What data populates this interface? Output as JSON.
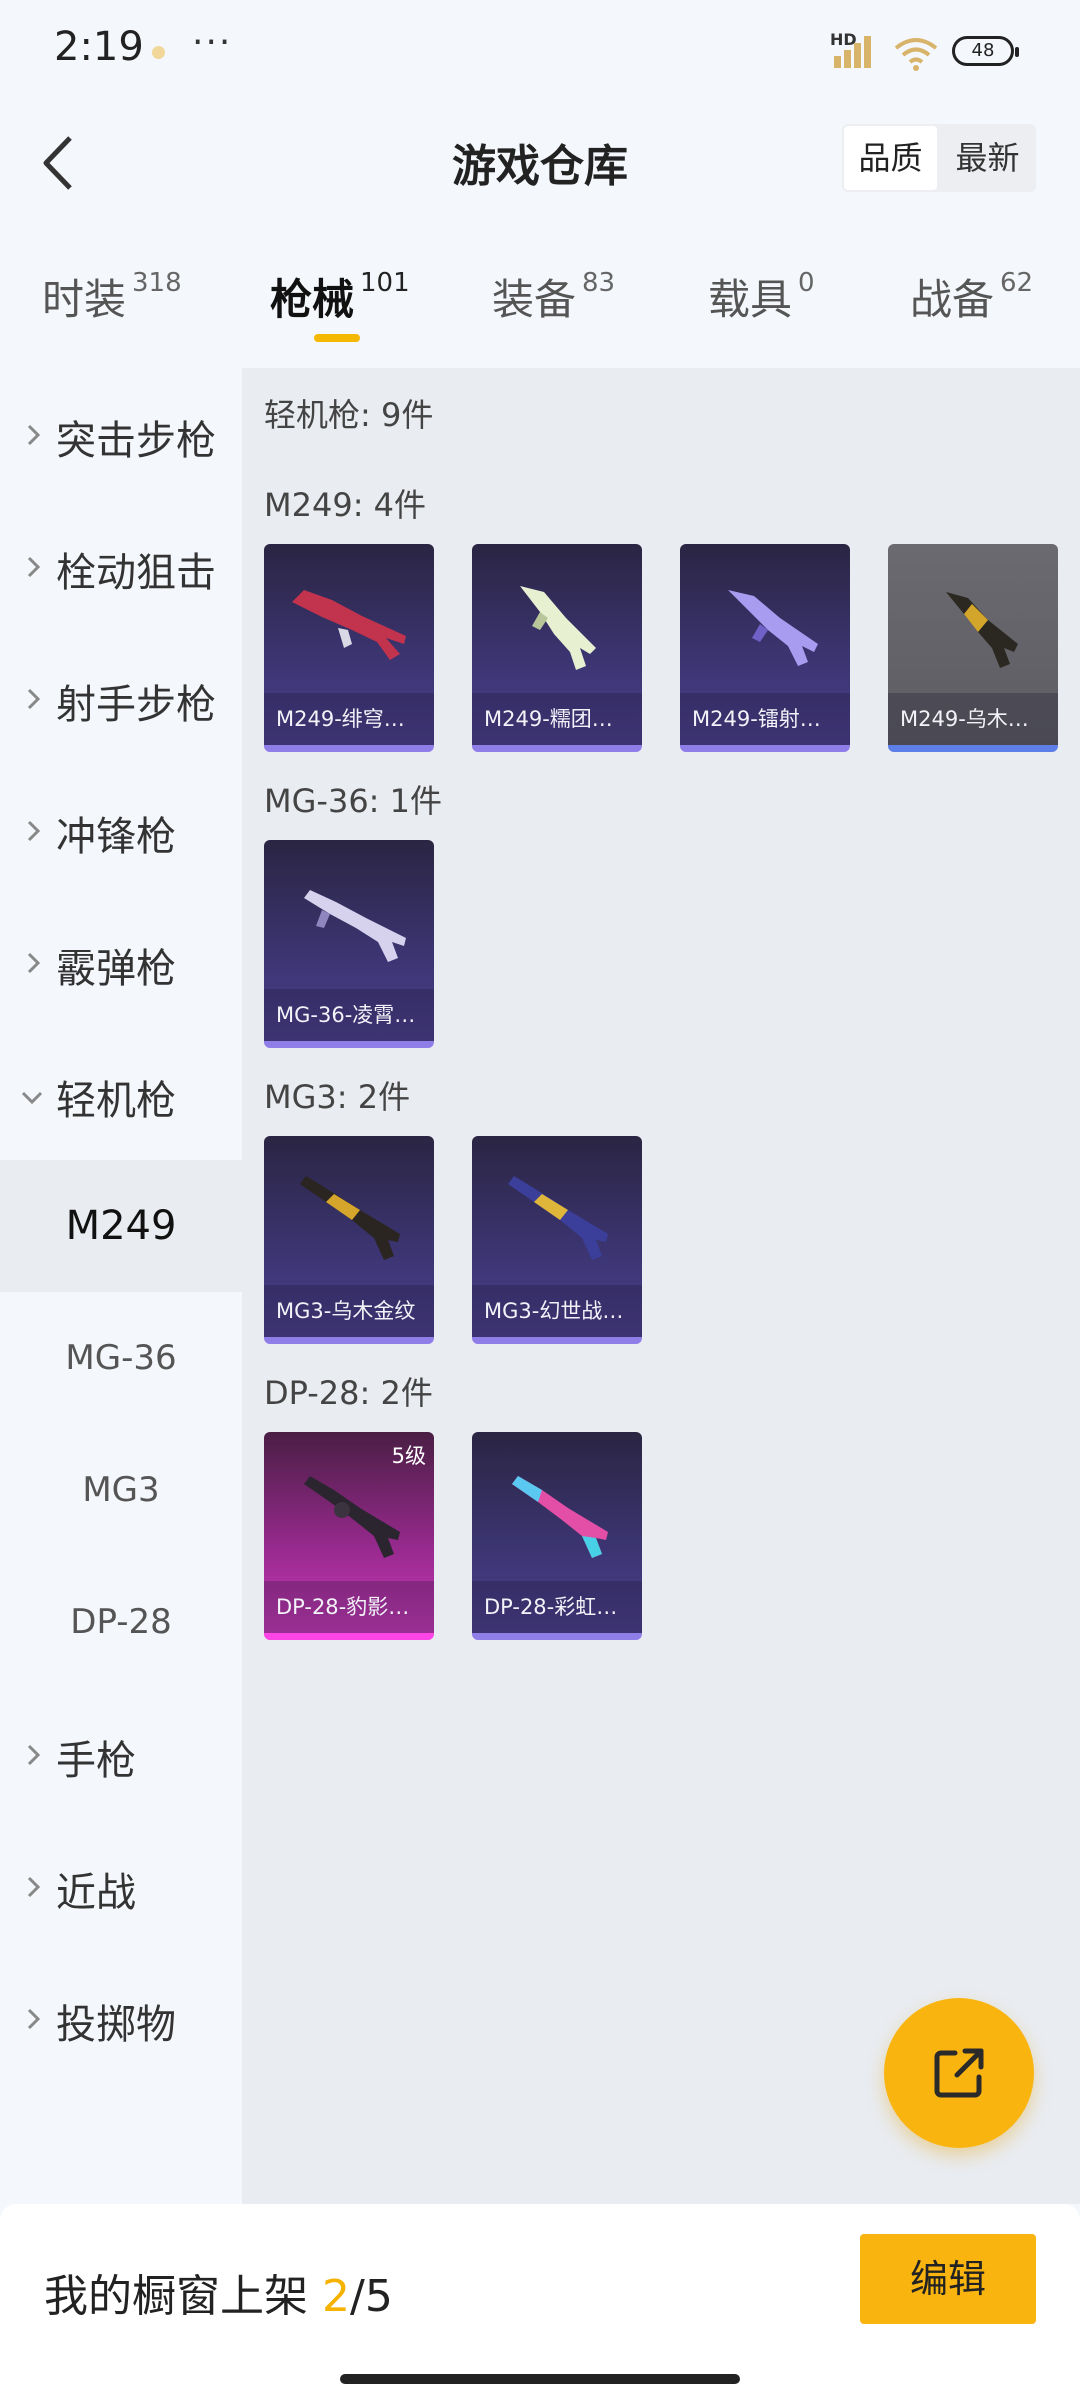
{
  "status": {
    "time": "2:19",
    "more": "···",
    "hd": "HD",
    "battery": "48"
  },
  "header": {
    "title": "游戏仓库",
    "sort_options": [
      "品质",
      "最新"
    ],
    "sort_active": "品质"
  },
  "category_tabs": [
    {
      "label": "时装",
      "count": "318"
    },
    {
      "label": "枪械",
      "count": "101",
      "active": true
    },
    {
      "label": "装备",
      "count": "83"
    },
    {
      "label": "载具",
      "count": "0"
    },
    {
      "label": "战备",
      "count": "62"
    }
  ],
  "sidebar": {
    "items": [
      "突击步枪",
      "栓动狙击",
      "射手步枪",
      "冲锋枪",
      "霰弹枪",
      "轻机枪",
      "手枪",
      "近战",
      "投掷物"
    ],
    "expanded": "轻机枪",
    "sub_items": [
      "M249",
      "MG-36",
      "MG3",
      "DP-28"
    ],
    "sub_active": "M249"
  },
  "content": {
    "total": "轻机枪: 9件",
    "sections": [
      {
        "title": "M249: 4件",
        "cards": [
          {
            "name": "M249-绯穹…"
          },
          {
            "name": "M249-糯团…"
          },
          {
            "name": "M249-镭射…"
          },
          {
            "name": "M249-乌木…"
          }
        ]
      },
      {
        "title": "MG-36: 1件",
        "cards": [
          {
            "name": "MG-36-凌霄…"
          }
        ]
      },
      {
        "title": "MG3: 2件",
        "cards": [
          {
            "name": "MG3-乌木金纹"
          },
          {
            "name": "MG3-幻世战…"
          }
        ]
      },
      {
        "title": "DP-28: 2件",
        "cards": [
          {
            "name": "DP-28-豹影…",
            "level": "5级"
          },
          {
            "name": "DP-28-彩虹…"
          }
        ]
      }
    ]
  },
  "bottom": {
    "showcase_label": "我的橱窗上架",
    "showcase_current": "2",
    "showcase_total": "/5",
    "edit_label": "编辑"
  },
  "colors": {
    "accent": "#f9b40f",
    "purple_quality": "#8f7de8",
    "pink_quality": "#ff45e6",
    "blue_quality": "#5e7fe8"
  }
}
